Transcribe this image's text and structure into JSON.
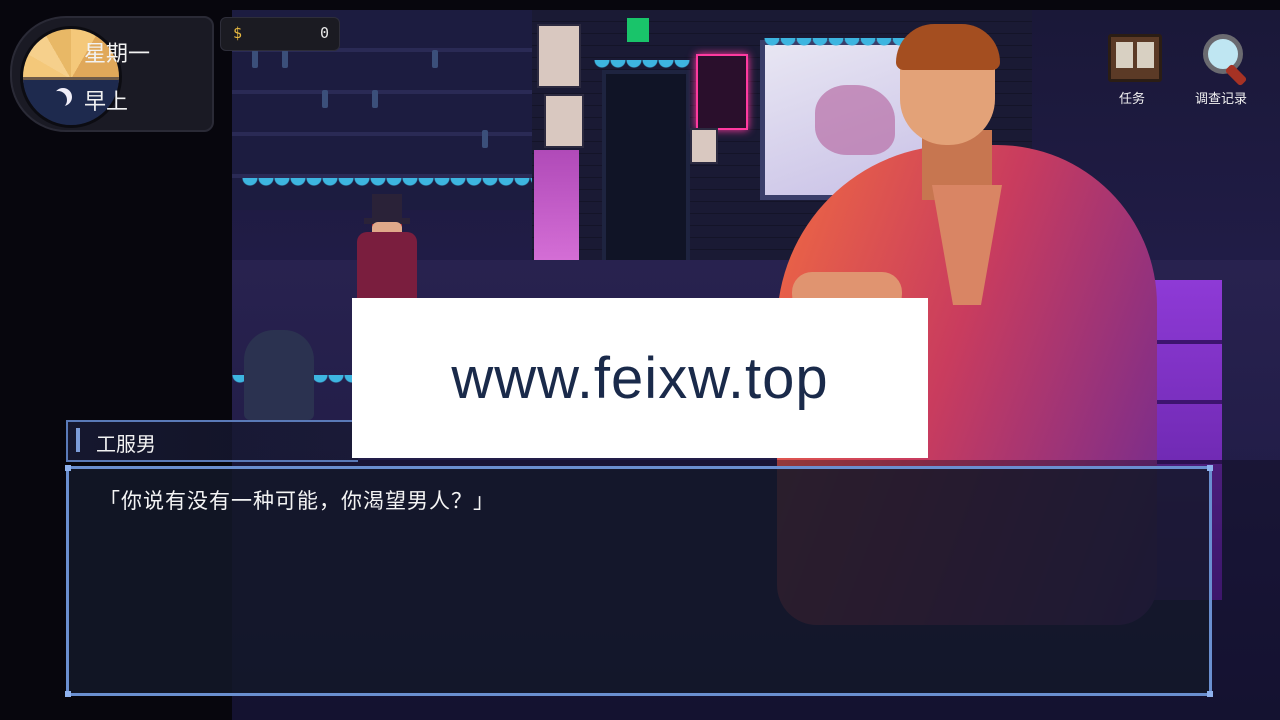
{
  "time": {
    "day": "星期一",
    "period": "早上",
    "icon": "moon-icon"
  },
  "money": {
    "symbol": "$",
    "value": "0"
  },
  "hud": {
    "quest_label": "任务",
    "investigation_label": "调查记录"
  },
  "dialogue": {
    "speaker": "工服男",
    "text": "「你说有没有一种可能，你渴望男人？」"
  },
  "watermark": {
    "text": "www.feixw.top"
  },
  "colors": {
    "dialog_border": "#6a8fd0",
    "money_symbol": "#e6b840",
    "accent_neon": "#ff3aa0"
  }
}
